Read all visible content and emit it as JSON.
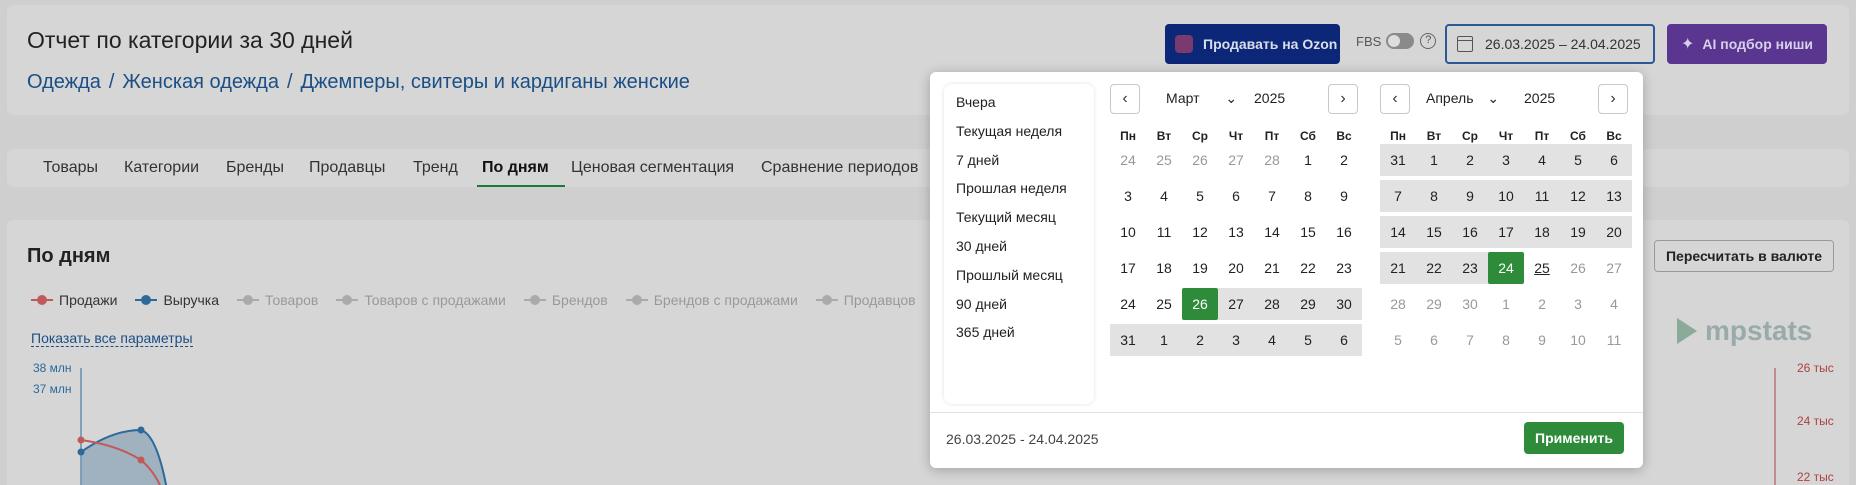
{
  "header": {
    "title": "Отчет по категории за 30 дней",
    "breadcrumb": [
      "Одежда",
      "Женская одежда",
      "Джемперы, свитеры и кардиганы женские"
    ],
    "breadcrumb_sep": "/",
    "ozon_button": "Продавать на Ozon",
    "fbs_label": "FBS",
    "help_glyph": "?",
    "date_range": "26.03.2025 – 24.04.2025",
    "ai_button": "AI подбор ниши"
  },
  "tabs": [
    "Товары",
    "Категории",
    "Бренды",
    "Продавцы",
    "Тренд",
    "По дням",
    "Ценовая сегментация",
    "Сравнение периодов"
  ],
  "active_tab": "По дням",
  "section": {
    "title": "По дням",
    "legend": [
      {
        "label": "Продажи",
        "color": "#c05a5a",
        "on": true
      },
      {
        "label": "Выручка",
        "color": "#2d6a9a",
        "on": true
      },
      {
        "label": "Товаров",
        "color": "#aaaaaa",
        "on": false
      },
      {
        "label": "Товаров с продажами",
        "color": "#aaaaaa",
        "on": false
      },
      {
        "label": "Брендов",
        "color": "#aaaaaa",
        "on": false
      },
      {
        "label": "Брендов с продажами",
        "color": "#aaaaaa",
        "on": false
      },
      {
        "label": "Продавцов",
        "color": "#aaaaaa",
        "on": false
      }
    ],
    "show_params": "Показать все параметры",
    "left_ticks": [
      "38 млн",
      "37 млн"
    ],
    "right_ticks": [
      "26 тыс",
      "24 тыс",
      "22 тыс"
    ],
    "recalc_button": "Пересчитать в валюте",
    "logo_text": "mpstats"
  },
  "picker": {
    "presets": [
      "Вчера",
      "Текущая неделя",
      "7 дней",
      "Прошлая неделя",
      "Текущий месяц",
      "30 дней",
      "Прошлый месяц",
      "90 дней",
      "365 дней"
    ],
    "weekdays": [
      "Пн",
      "Вт",
      "Ср",
      "Чт",
      "Пт",
      "Сб",
      "Вс"
    ],
    "left": {
      "month": "Март",
      "year": "2025",
      "weeks": [
        [
          "24",
          "25",
          "26",
          "27",
          "28",
          "1",
          "2"
        ],
        [
          "3",
          "4",
          "5",
          "6",
          "7",
          "8",
          "9"
        ],
        [
          "10",
          "11",
          "12",
          "13",
          "14",
          "15",
          "16"
        ],
        [
          "17",
          "18",
          "19",
          "20",
          "21",
          "22",
          "23"
        ],
        [
          "24",
          "25",
          "26",
          "27",
          "28",
          "29",
          "30"
        ],
        [
          "31",
          "1",
          "2",
          "3",
          "4",
          "5",
          "6"
        ]
      ]
    },
    "right": {
      "month": "Апрель",
      "year": "2025",
      "weeks": [
        [
          "31",
          "1",
          "2",
          "3",
          "4",
          "5",
          "6"
        ],
        [
          "7",
          "8",
          "9",
          "10",
          "11",
          "12",
          "13"
        ],
        [
          "14",
          "15",
          "16",
          "17",
          "18",
          "19",
          "20"
        ],
        [
          "21",
          "22",
          "23",
          "24",
          "25",
          "26",
          "27"
        ],
        [
          "28",
          "29",
          "30",
          "1",
          "2",
          "3",
          "4"
        ],
        [
          "5",
          "6",
          "7",
          "8",
          "9",
          "10",
          "11"
        ]
      ]
    },
    "range_text": "26.03.2025 - 24.04.2025",
    "apply_button": "Применить",
    "prev_glyph": "‹",
    "next_glyph": "›",
    "select_glyph": "⌄",
    "colors": {
      "selected": "#2e8b3a",
      "range": "#e2e2e2"
    }
  }
}
